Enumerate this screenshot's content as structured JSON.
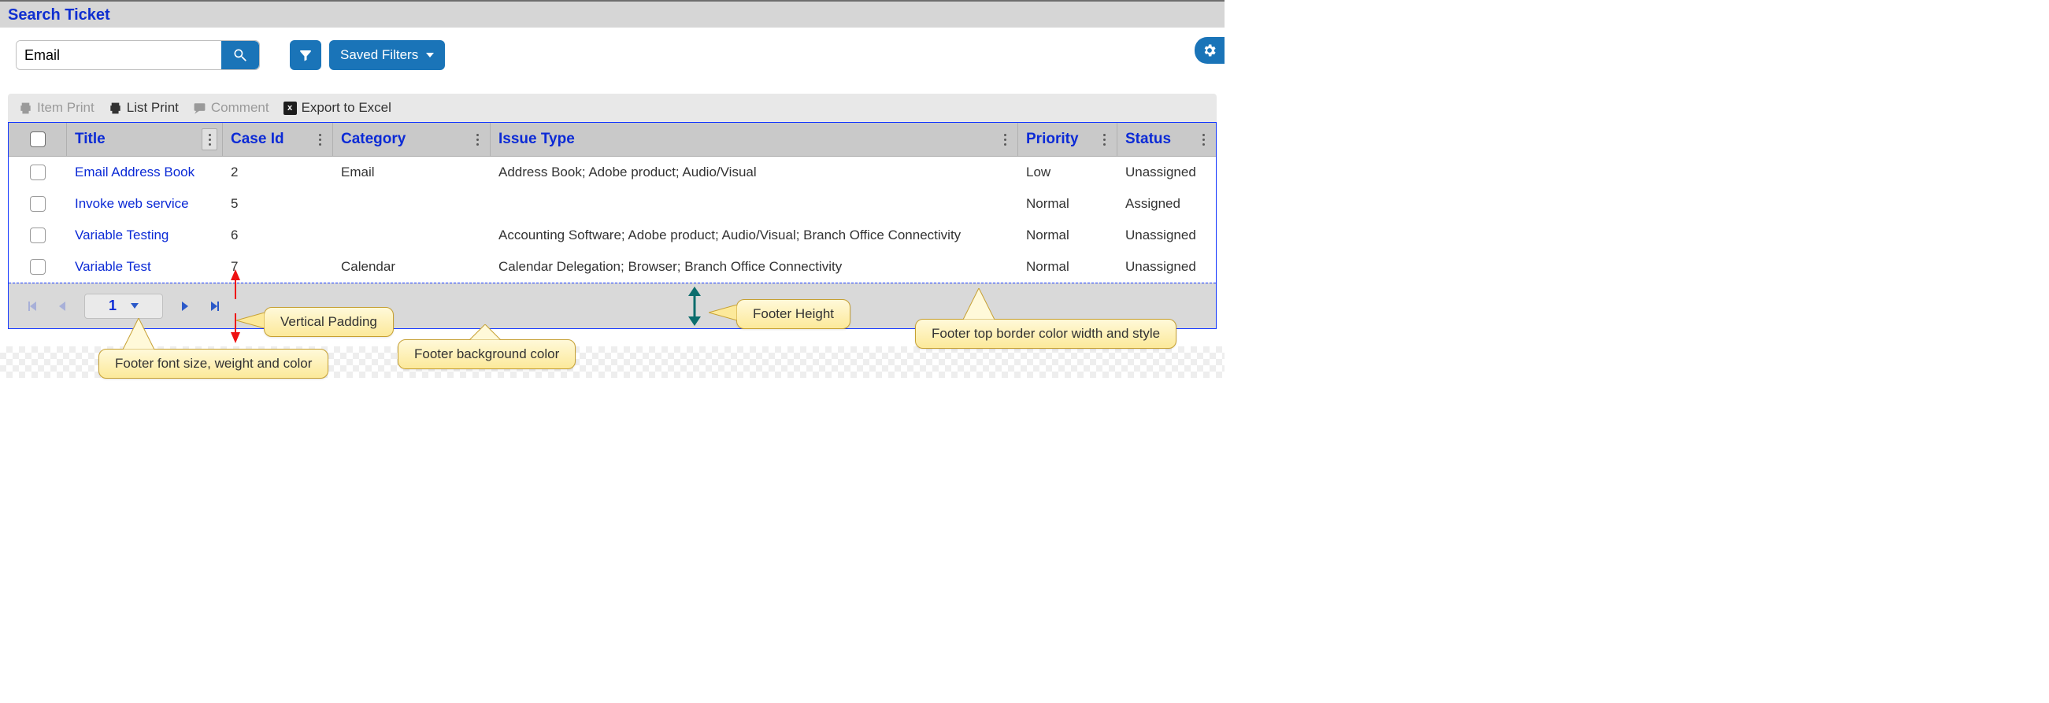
{
  "header": {
    "title": "Search Ticket"
  },
  "search": {
    "value": "Email",
    "saved_filters_label": "Saved Filters"
  },
  "toolbar": {
    "item_print": "Item Print",
    "list_print": "List Print",
    "comment": "Comment",
    "export_excel": "Export to Excel"
  },
  "columns": {
    "title": "Title",
    "case_id": "Case Id",
    "category": "Category",
    "issue_type": "Issue Type",
    "priority": "Priority",
    "status": "Status"
  },
  "rows": [
    {
      "title": "Email Address Book",
      "case_id": "2",
      "category": "Email",
      "issue_type": "Address Book; Adobe product; Audio/Visual",
      "priority": "Low",
      "status": "Unassigned"
    },
    {
      "title": "Invoke web service",
      "case_id": "5",
      "category": "",
      "issue_type": "",
      "priority": "Normal",
      "status": "Assigned"
    },
    {
      "title": "Variable Testing",
      "case_id": "6",
      "category": "",
      "issue_type": "Accounting Software; Adobe product; Audio/Visual; Branch Office Connectivity",
      "priority": "Normal",
      "status": "Unassigned"
    },
    {
      "title": "Variable Test",
      "case_id": "7",
      "category": "Calendar",
      "issue_type": "Calendar Delegation; Browser; Branch Office Connectivity",
      "priority": "Normal",
      "status": "Unassigned"
    }
  ],
  "pager": {
    "current": "1"
  },
  "callouts": {
    "vpadding": "Vertical Padding",
    "bgcolor": "Footer background color",
    "height": "Footer Height",
    "border": "Footer top border color width and style",
    "font": "Footer font size, weight and color"
  }
}
